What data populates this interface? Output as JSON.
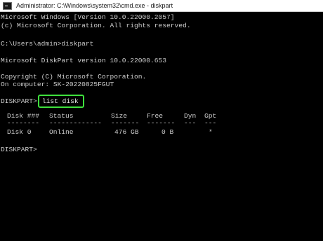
{
  "window": {
    "title": "Administrator: C:\\Windows\\system32\\cmd.exe - diskpart"
  },
  "console": {
    "lines": {
      "version": "Microsoft Windows [Version 10.0.22000.2057]",
      "copyright_ms": "(c) Microsoft Corporation. All rights reserved.",
      "prompt_cmd": "C:\\Users\\admin>diskpart",
      "diskpart_version": "Microsoft DiskPart version 10.0.22000.653",
      "copyright": "Copyright (C) Microsoft Corporation.",
      "computer": "On computer: SK-20220825FGUT",
      "prompt_final": "DISKPART>"
    },
    "command": {
      "prompt": "DISKPART>",
      "text": "list disk",
      "highlight_color": "#3ee03c"
    },
    "disk_table": {
      "headers": {
        "disk": "Disk ###",
        "status": "Status",
        "size": "Size",
        "free": "Free",
        "dyn": "Dyn",
        "gpt": "Gpt"
      },
      "separators": {
        "disk": "--------",
        "status": "-------------",
        "size": "-------",
        "free": "-------",
        "dyn": "---",
        "gpt": "---"
      },
      "rows": [
        {
          "disk": "Disk 0",
          "status": "Online",
          "size": "476 GB",
          "free": "0 B",
          "dyn": "",
          "gpt": "*"
        }
      ]
    }
  }
}
